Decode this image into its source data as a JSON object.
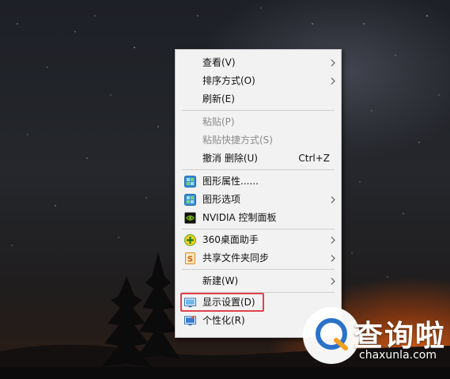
{
  "context_menu": {
    "items": {
      "view": {
        "label": "查看(V)"
      },
      "sort_by": {
        "label": "排序方式(O)"
      },
      "refresh": {
        "label": "刷新(E)"
      },
      "paste": {
        "label": "粘贴(P)"
      },
      "paste_shortcut": {
        "label": "粘贴快捷方式(S)"
      },
      "undo_delete": {
        "label": "撤消 删除(U)",
        "shortcut": "Ctrl+Z"
      },
      "graphics_properties": {
        "label": "图形属性......"
      },
      "graphics_options": {
        "label": "图形选项"
      },
      "nvidia_control_panel": {
        "label": "NVIDIA 控制面板"
      },
      "desktop_assistant_360": {
        "label": "360桌面助手"
      },
      "shared_folder_sync": {
        "label": "共享文件夹同步"
      },
      "new": {
        "label": "新建(W)"
      },
      "display_settings": {
        "label": "显示设置(D)"
      },
      "personalize": {
        "label": "个性化(R)"
      }
    },
    "highlight_color": "#e0424b"
  },
  "watermark": {
    "brand_cn": "查询啦",
    "brand_en": "chaxunla.com"
  }
}
